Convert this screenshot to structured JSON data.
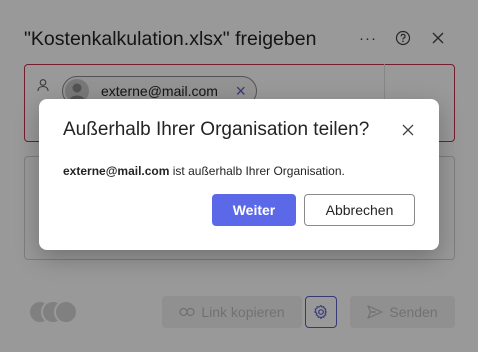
{
  "share_panel": {
    "title": "\"Kostenkalkulation.xlsx\" freigeben",
    "recipient_chip": {
      "label": "externe@mail.com"
    },
    "link_button_label": "Link kopieren",
    "send_button_label": "Senden",
    "icons": {
      "more": "more-icon",
      "help": "help-icon",
      "close": "close-icon",
      "person": "person-icon",
      "link": "link-icon",
      "gear": "gear-icon",
      "send": "send-icon"
    }
  },
  "dialog": {
    "title": "Außerhalb Ihrer Organisation teilen?",
    "message_email": "externe@mail.com",
    "message_suffix": " ist außerhalb Ihrer Organisation.",
    "primary_label": "Weiter",
    "secondary_label": "Abbrechen"
  },
  "colors": {
    "accent": "#5b69e8",
    "error_border": "#c4314b",
    "overlay": "rgba(0,0,0,0.40)"
  }
}
